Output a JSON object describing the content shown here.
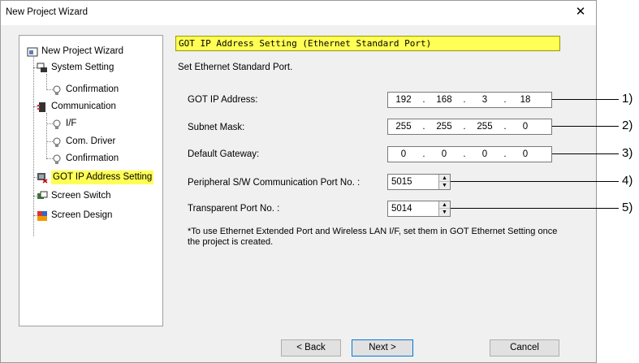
{
  "window": {
    "title": "New Project Wizard",
    "close_glyph": "✕"
  },
  "tree": {
    "items": [
      {
        "label": "New Project Wizard",
        "icon": "wizard-icon"
      },
      {
        "label": "System Setting",
        "icon": "system-icon"
      },
      {
        "label": "Confirmation",
        "icon": "bulb-icon"
      },
      {
        "label": "Communication",
        "icon": "communication-icon"
      },
      {
        "label": "I/F",
        "icon": "bulb-icon"
      },
      {
        "label": "Com. Driver",
        "icon": "bulb-icon"
      },
      {
        "label": "Confirmation",
        "icon": "bulb-icon"
      },
      {
        "label": "GOT IP Address Setting",
        "icon": "ip-address-icon",
        "selected": true
      },
      {
        "label": "Screen Switch",
        "icon": "screen-switch-icon"
      },
      {
        "label": "Screen Design",
        "icon": "screen-design-icon"
      }
    ]
  },
  "panel": {
    "heading": "GOT IP Address Setting (Ethernet Standard Port)",
    "description": "Set Ethernet Standard Port.",
    "fields": {
      "ip_label": "GOT IP Address:",
      "ip": [
        "192",
        "168",
        "3",
        "18"
      ],
      "mask_label": "Subnet Mask:",
      "mask": [
        "255",
        "255",
        "255",
        "0"
      ],
      "gateway_label": "Default Gateway:",
      "gateway": [
        "0",
        "0",
        "0",
        "0"
      ],
      "periph_label": "Peripheral S/W Communication Port No. :",
      "periph_value": "5015",
      "transparent_label": "Transparent Port No. :",
      "transparent_value": "5014"
    },
    "note": "*To use Ethernet Extended Port and Wireless LAN I/F, set them in GOT Ethernet Setting once the project is created."
  },
  "buttons": {
    "back": "< Back",
    "next": "Next >",
    "cancel": "Cancel"
  },
  "callouts": [
    "1)",
    "2)",
    "3)",
    "4)",
    "5)"
  ],
  "colors": {
    "highlight": "#ffff55",
    "dialog_bg": "#f0f0f0",
    "primary_border": "#0078d7"
  }
}
